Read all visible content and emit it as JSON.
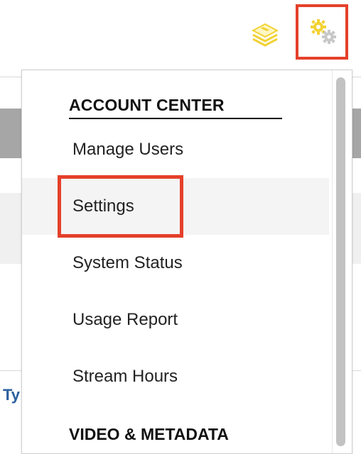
{
  "background": {
    "link_text": "Ty"
  },
  "toolbar": {
    "layers_icon": "layers-icon",
    "settings_icon": "gears-icon",
    "colors": {
      "highlight": "#e5402a",
      "gear_yellow": "#f2d234",
      "gear_gray": "#c7c7c7"
    }
  },
  "dropdown": {
    "section_title": "ACCOUNT CENTER",
    "items": [
      {
        "label": "Manage Users"
      },
      {
        "label": "Settings"
      },
      {
        "label": "System Status"
      },
      {
        "label": "Usage Report"
      },
      {
        "label": "Stream Hours"
      }
    ],
    "next_section_title": "VIDEO & METADATA"
  }
}
